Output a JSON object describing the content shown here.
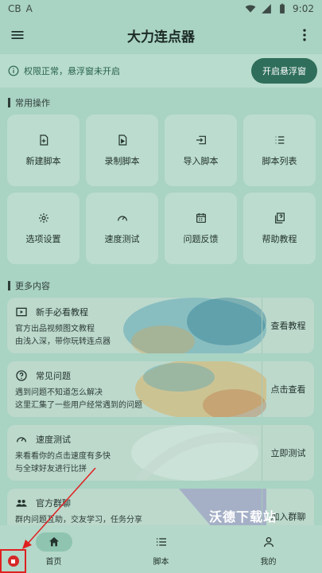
{
  "status": {
    "left_icons": [
      "CB",
      "A"
    ],
    "time": "9:02"
  },
  "appbar": {
    "title": "大力连点器"
  },
  "permission": {
    "message": "权限正常，悬浮窗未开启",
    "button": "开启悬浮窗"
  },
  "sections": {
    "common": "常用操作",
    "more": "更多内容"
  },
  "tiles": [
    {
      "label": "新建脚本",
      "icon": "new-file-icon"
    },
    {
      "label": "录制脚本",
      "icon": "record-file-icon"
    },
    {
      "label": "导入脚本",
      "icon": "import-icon"
    },
    {
      "label": "脚本列表",
      "icon": "list-icon"
    },
    {
      "label": "选项设置",
      "icon": "gear-icon"
    },
    {
      "label": "速度测试",
      "icon": "speedometer-icon"
    },
    {
      "label": "问题反馈",
      "icon": "calendar-icon"
    },
    {
      "label": "帮助教程",
      "icon": "help-book-icon"
    }
  ],
  "cards": [
    {
      "title": "新手必看教程",
      "line1": "官方出品视频图文教程",
      "line2": "由浅入深，带你玩转连点器",
      "action": "查看教程",
      "icon": "video-icon"
    },
    {
      "title": "常见问题",
      "line1": "遇到问题不知道怎么解决",
      "line2": "这里汇集了一些用户经常遇到的问题",
      "action": "点击查看",
      "icon": "question-icon"
    },
    {
      "title": "速度测试",
      "line1": "来看看你的点击速度有多快",
      "line2": "与全球好友进行比拼",
      "action": "立即测试",
      "icon": "speedometer-icon"
    },
    {
      "title": "官方群聊",
      "line1": "群内问题互助，交友学习，任务分享",
      "line2": "",
      "action": "加入群聊",
      "icon": "group-icon"
    }
  ],
  "nav": [
    {
      "label": "首页",
      "icon": "home-icon",
      "active": true
    },
    {
      "label": "脚本",
      "icon": "list-icon",
      "active": false
    },
    {
      "label": "我的",
      "icon": "person-icon",
      "active": false
    }
  ],
  "watermark": "沃德下载站",
  "colors": {
    "accent": "#2f6e5b",
    "background": "#a9d3c3",
    "annotation": "#e02020"
  }
}
